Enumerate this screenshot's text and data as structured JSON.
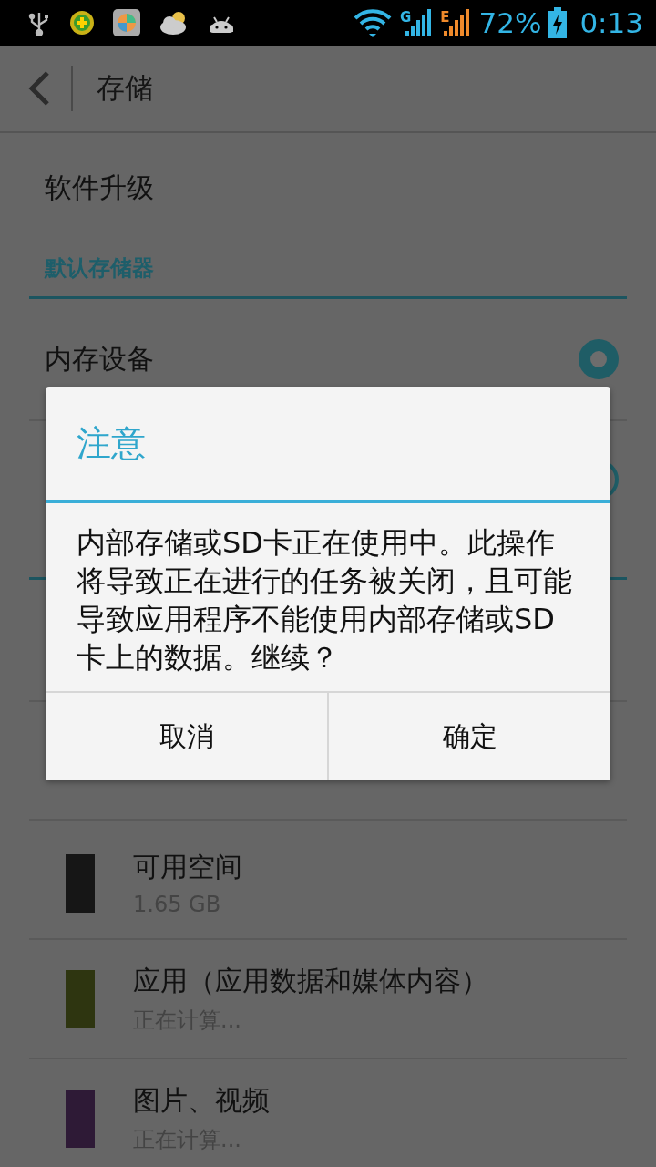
{
  "status_bar": {
    "network_g": "G",
    "network_e": "E",
    "battery": "72%",
    "time": "0:13"
  },
  "action_bar": {
    "title": "存储"
  },
  "list": [
    {
      "kind": "item",
      "label": "软件升级"
    },
    {
      "kind": "header",
      "label": "默认存储器"
    },
    {
      "kind": "radio",
      "label": "内存设备",
      "selected": true
    },
    {
      "kind": "radio",
      "selected": false
    },
    {
      "kind": "header"
    },
    {
      "kind": "blank"
    },
    {
      "kind": "blank"
    },
    {
      "kind": "storage",
      "label": "可用空间",
      "detail": "1.65 GB",
      "color": "#161616"
    },
    {
      "kind": "storage",
      "label": "应用（应用数据和媒体内容）",
      "detail": "正在计算...",
      "color": "#2e3510"
    },
    {
      "kind": "storage",
      "label": "图片、视频",
      "detail": "正在计算...",
      "color": "#2e1a36"
    }
  ],
  "dialog": {
    "title": "注意",
    "message": "内部存储或SD卡正在使用中。此操作将导致正在进行的任务被关闭，且可能导致应用程序不能使用内部存储或SD卡上的数据。继续？",
    "buttons": [
      "取消",
      "确定"
    ]
  }
}
